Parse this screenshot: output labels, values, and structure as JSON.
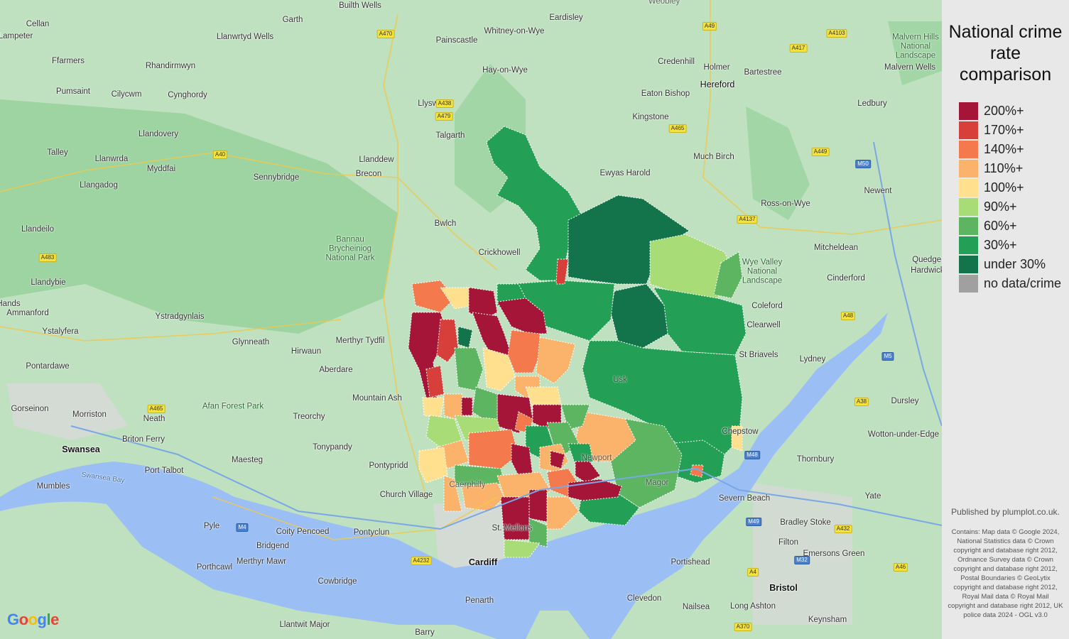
{
  "colors": {
    "land": "#bfe1c0",
    "sea": "#9bbff4",
    "panel": "#e8e8e8",
    "band_200": "#a51537",
    "band_170": "#d73f3a",
    "band_140": "#f4794d",
    "band_110": "#fbb26b",
    "band_100": "#fee08e",
    "band_90": "#a8dc77",
    "band_60": "#5db562",
    "band_30": "#23a055",
    "band_under30": "#13734a",
    "band_nodata": "#a0a0a0"
  },
  "legend": {
    "title": "National crime rate comparison",
    "items": [
      {
        "label": "200%+",
        "color": "#a51537"
      },
      {
        "label": "170%+",
        "color": "#d73f3a"
      },
      {
        "label": "140%+",
        "color": "#f4794d"
      },
      {
        "label": "110%+",
        "color": "#fbb26b"
      },
      {
        "label": "100%+",
        "color": "#fee08e"
      },
      {
        "label": "90%+",
        "color": "#a8dc77"
      },
      {
        "label": "60%+",
        "color": "#5db562"
      },
      {
        "label": "30%+",
        "color": "#23a055"
      },
      {
        "label": "under 30%",
        "color": "#13734a"
      },
      {
        "label": "no data/crime",
        "color": "#a0a0a0"
      }
    ]
  },
  "attribution": {
    "published": "Published by plumplot.co.uk.",
    "contains": "Contains: Map data © Google 2024, National Statistics data © Crown copyright and database right 2012, Ordnance Survey data © Crown copyright and database right 2012, Postal Boundaries © GeoLytix copyright and database right 2012, Royal Mail data © Royal Mail copyright and database right 2012, UK police data 2024 - OGL v3.0"
  },
  "places": [
    "Builth Wells",
    "Cellan",
    "Garth",
    "Eardisley",
    "Weobley",
    "Lampeter",
    "Llanwrtyd Wells",
    "Painscastle",
    "Whitney-on-Wye",
    "Malvern Hills National Landscape",
    "Malvern Wells",
    "Ffarmers",
    "Rhandirmwyn",
    "Credenhill",
    "Holmer",
    "Bartestree",
    "Hay-on-Wye",
    "Hereford",
    "Pumsaint",
    "Cilycwm",
    "Cynghordy",
    "Eaton Bishop",
    "Llyswen",
    "Ledbury",
    "Talgarth",
    "Kingstone",
    "Llandovery",
    "Much Birch",
    "Talley",
    "Llanwrda",
    "Myddfai",
    "Llanddew",
    "Ewyas Harold",
    "Sennybridge",
    "Brecon",
    "Newent",
    "Llangadog",
    "Ross-on-Wye",
    "Llandeilo",
    "Bwlch",
    "Bannau Brycheiniog National Park",
    "Mitcheldean",
    "Crickhowell",
    "Wye Valley National Landscape",
    "Llandybie",
    "Cinderford",
    "Quedgeley",
    "Hardwicke",
    "Ammanford",
    "Hands",
    "Ystradgynlais",
    "Coleford",
    "Ystalyfera",
    "Clearwell",
    "Merthyr Tydfil",
    "Glynneath",
    "Hirwaun",
    "St Briavels",
    "Lydney",
    "Pontardawe",
    "Aberdare",
    "Gorseinon",
    "Morriston",
    "Mountain Ash",
    "Neath",
    "Afan Forest Park",
    "Treorchy",
    "Dursley",
    "Swansea",
    "Briton Ferry",
    "Tonypandy",
    "Chepstow",
    "Wotton-under-Edge",
    "Swansea Bay",
    "Port Talbot",
    "Maesteg",
    "Pontypridd",
    "Thornbury",
    "Mumbles",
    "Church Village",
    "Severn Beach",
    "Yate",
    "Pyle",
    "Coity Pencoed",
    "Pontyclun",
    "St. Mellons",
    "Bradley Stoke",
    "Bridgend",
    "Filton",
    "Emersons Green",
    "Porthcawl",
    "Merthyr Mawr",
    "Cardiff",
    "Portishead",
    "Cowbridge",
    "Bristol",
    "Penarth",
    "Clevedon",
    "Nailsea",
    "Long Ashton",
    "Llantwit Major",
    "Keynsham",
    "Barry",
    "Usk",
    "Magor",
    "Caerphilly",
    "Newport"
  ],
  "roads": [
    "A470",
    "A49",
    "A4103",
    "A438",
    "A417",
    "A479",
    "A465",
    "A449",
    "A40",
    "M50",
    "A483",
    "A4137",
    "A48",
    "A465",
    "M5",
    "A38",
    "M48",
    "M4",
    "M49",
    "A432",
    "A4232",
    "M32",
    "A4",
    "A46",
    "A370"
  ]
}
